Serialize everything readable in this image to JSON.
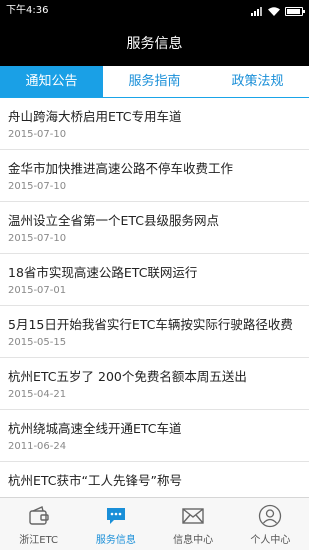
{
  "status_bar": {
    "time": "下午4:36",
    "battery_level": 0.9
  },
  "header": {
    "title": "服务信息"
  },
  "tabs": [
    {
      "label": "通知公告",
      "active": true
    },
    {
      "label": "服务指南",
      "active": false
    },
    {
      "label": "政策法规",
      "active": false
    }
  ],
  "news": [
    {
      "title": "舟山跨海大桥启用ETC专用车道",
      "date": "2015-07-10"
    },
    {
      "title": "金华市加快推进高速公路不停车收费工作",
      "date": "2015-07-10"
    },
    {
      "title": "温州设立全省第一个ETC县级服务网点",
      "date": "2015-07-10"
    },
    {
      "title": "18省市实现高速公路ETC联网运行",
      "date": "2015-07-01"
    },
    {
      "title": "5月15日开始我省实行ETC车辆按实际行驶路径收费",
      "date": "2015-05-15"
    },
    {
      "title": "杭州ETC五岁了 200个免费名额本周五送出",
      "date": "2015-04-21"
    },
    {
      "title": "杭州绕城高速全线开通ETC车道",
      "date": "2011-06-24"
    },
    {
      "title": "杭州ETC获市“工人先锋号”称号",
      "date": ""
    }
  ],
  "bottom_nav": [
    {
      "label": "浙江ETC",
      "icon": "wallet-icon",
      "active": false
    },
    {
      "label": "服务信息",
      "icon": "chat-icon",
      "active": true
    },
    {
      "label": "信息中心",
      "icon": "mail-icon",
      "active": false
    },
    {
      "label": "个人中心",
      "icon": "person-icon",
      "active": false
    }
  ],
  "colors": {
    "accent": "#1aa0e6",
    "header_bg": "#000000"
  }
}
